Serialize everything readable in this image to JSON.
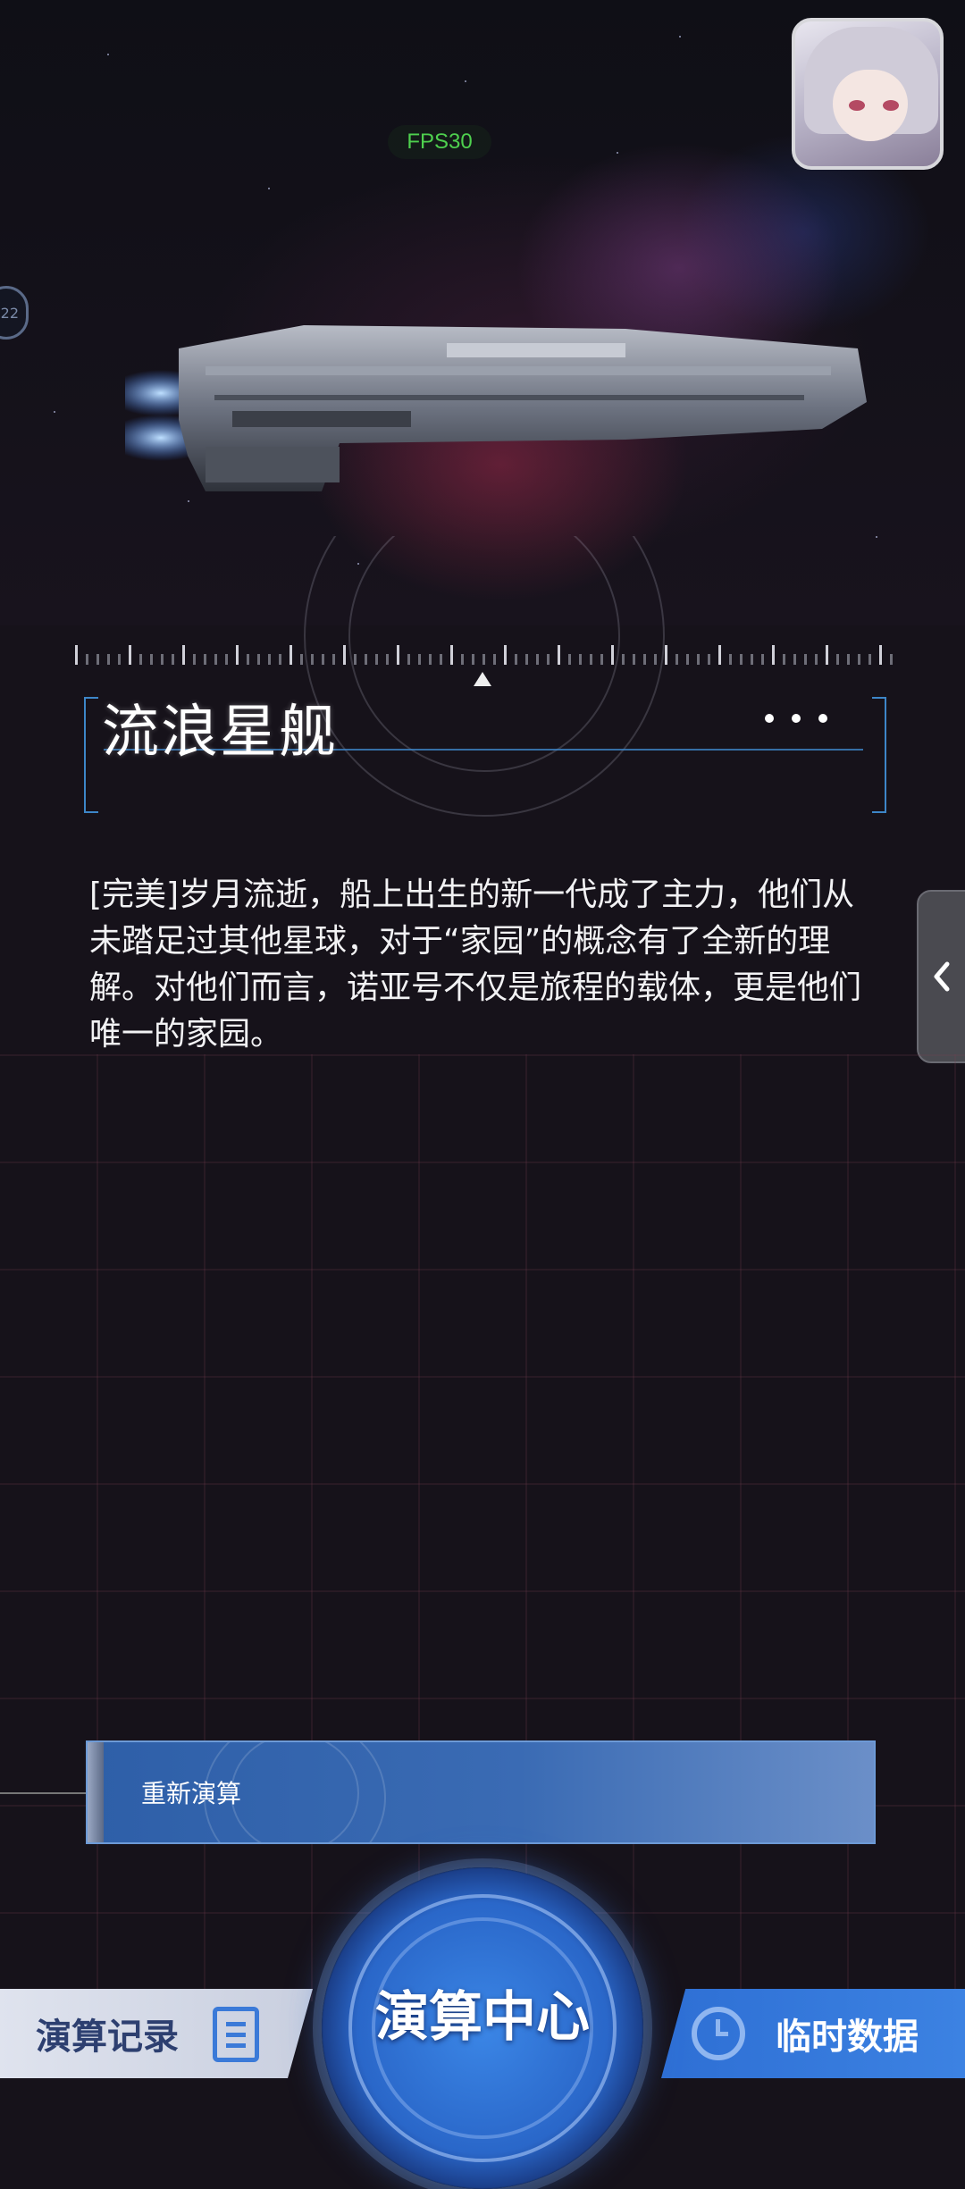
{
  "hud": {
    "fps": "FPS30",
    "side_badge": "22"
  },
  "ship": {
    "name": "流浪星舰"
  },
  "description": "[完美]岁月流逝，船上出生的新一代成了主力，他们从未踏足过其他星球，对于“家园”的概念有了全新的理解。对他们而言，诺亚号不仅是旅程的载体，更是他们唯一的家园。",
  "actions": {
    "recalculate": "重新演算"
  },
  "bottom_nav": {
    "left_label": "演算记录",
    "center_label": "演算中心",
    "right_label": "临时数据"
  },
  "colors": {
    "accent": "#3d86c8",
    "button_blue": "#2e6fd4",
    "fps_green": "#4ed04e"
  },
  "icons": [
    "avatar",
    "more-icon",
    "chevron-left-icon",
    "list-icon",
    "clock-icon"
  ]
}
